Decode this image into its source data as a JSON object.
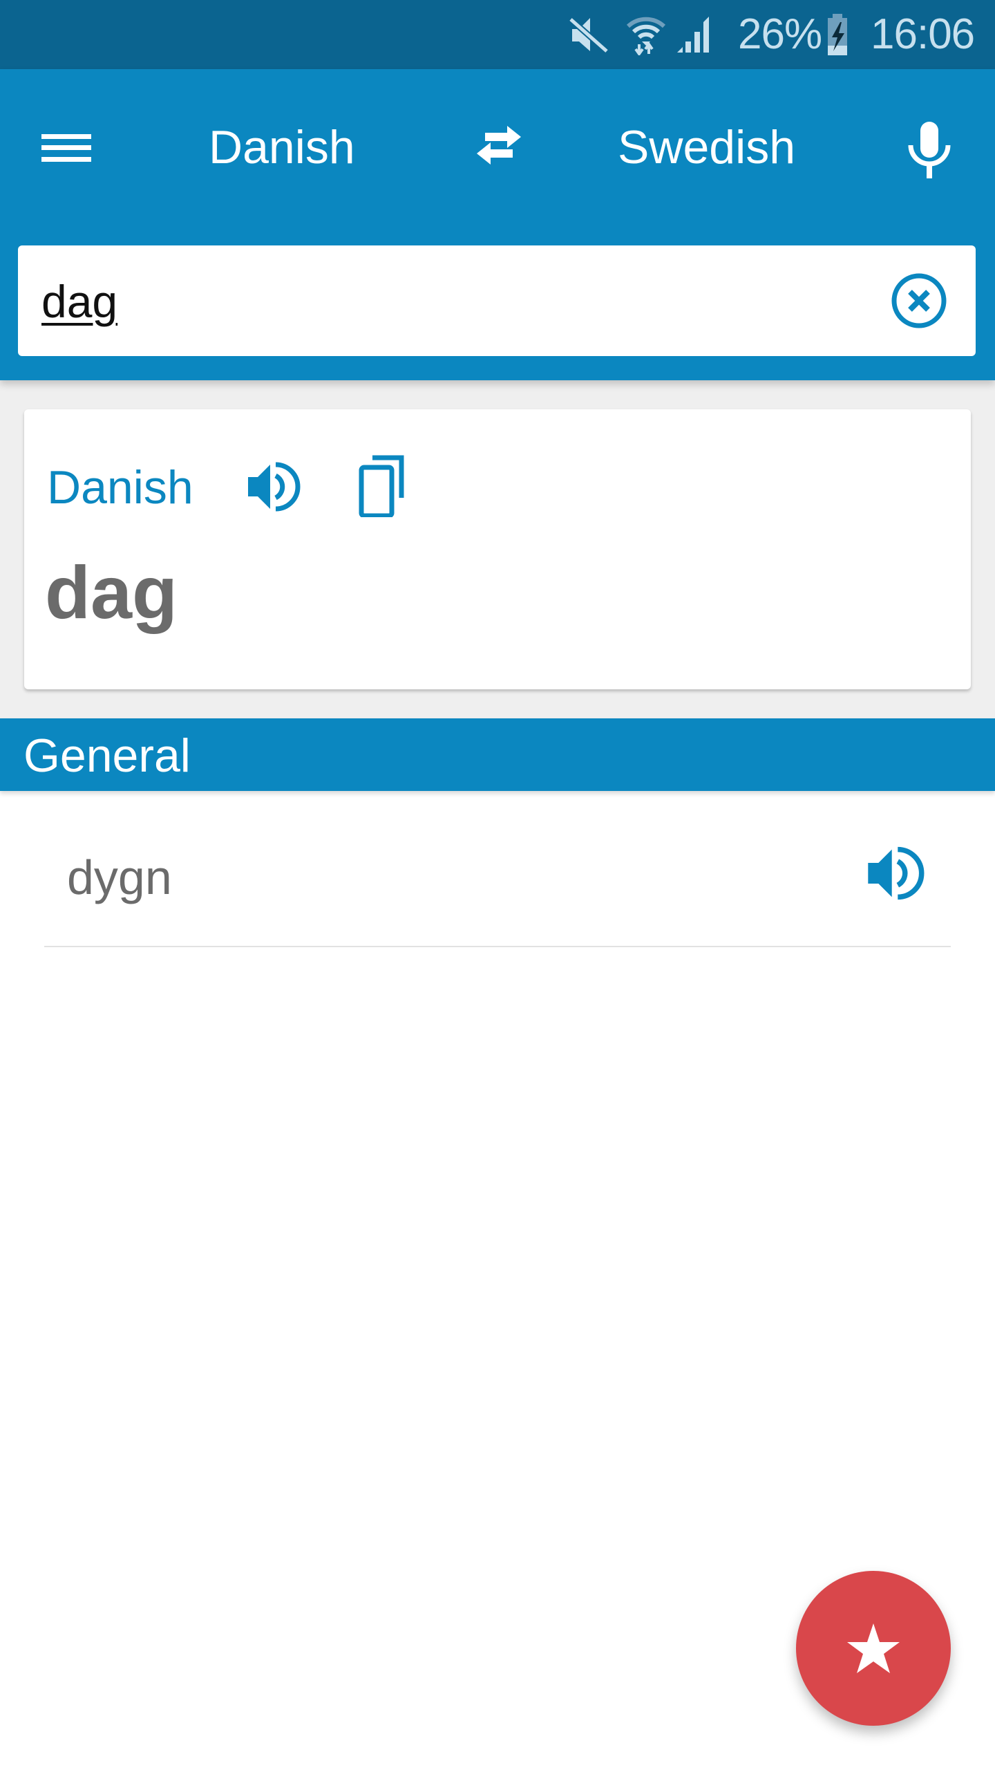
{
  "status_bar": {
    "battery_percent": "26%",
    "time": "16:06",
    "icons": [
      "mute-icon",
      "wifi-icon",
      "signal-icon",
      "battery-charging-icon"
    ]
  },
  "app_bar": {
    "menu_icon": "menu-icon",
    "source_language": "Danish",
    "swap_icon": "swap-icon",
    "target_language": "Swedish",
    "mic_icon": "mic-icon"
  },
  "search": {
    "value": "dag",
    "clear_icon": "clear-icon"
  },
  "source_card": {
    "language": "Danish",
    "word": "dag",
    "speak_icon": "speaker-icon",
    "copy_icon": "copy-icon"
  },
  "section": {
    "title": "General"
  },
  "results": [
    {
      "word": "dygn",
      "speak_icon": "speaker-icon"
    }
  ],
  "fab": {
    "icon": "star-icon"
  },
  "colors": {
    "status_bar": "#0b6490",
    "primary": "#0b87c0",
    "accent": "#d9474b",
    "text_gray": "#6b6b6b",
    "background_gray": "#efefef"
  }
}
